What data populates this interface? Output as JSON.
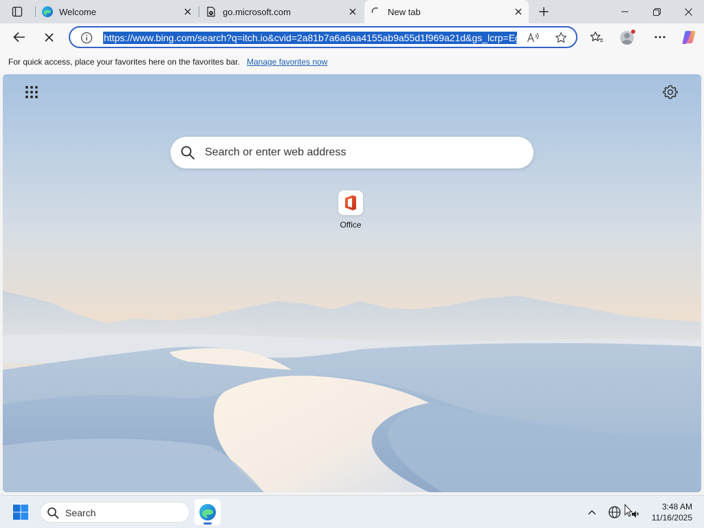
{
  "tabs": [
    {
      "title": "Welcome",
      "favicon": "edge-icon"
    },
    {
      "title": "go.microsoft.com",
      "favicon": "page-lock-icon"
    },
    {
      "title": "New tab",
      "favicon": "loading-spinner-icon"
    }
  ],
  "toolbar": {
    "url": "https://www.bing.com/search?q=itch.io&cvid=2a81b7a6a6aa4155ab9a55d1f969a21d&gs_lcrp=Eg",
    "read_aloud_label": "A⁾"
  },
  "favorites_bar": {
    "message": "For quick access, place your favorites here on the favorites bar.",
    "link": "Manage favorites now"
  },
  "new_tab_page": {
    "search_placeholder": "Search or enter web address",
    "tiles": [
      {
        "label": "Office",
        "icon": "office-icon"
      }
    ]
  },
  "taskbar": {
    "search_label": "Search",
    "time": "3:48 AM",
    "date": "11/16/2025"
  },
  "colors": {
    "accent": "#2f63c6",
    "url_selection": "#1d62c9",
    "link": "#1a5fb4"
  }
}
